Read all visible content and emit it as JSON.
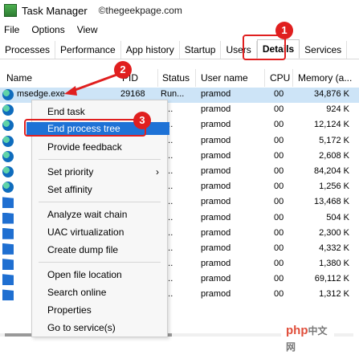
{
  "window": {
    "title": "Task Manager",
    "watermark": "©thegeekpage.com"
  },
  "menubar": [
    "File",
    "Options",
    "View"
  ],
  "tabs": [
    "Processes",
    "Performance",
    "App history",
    "Startup",
    "Users",
    "Details",
    "Services"
  ],
  "active_tab": "Details",
  "columns": {
    "name": "Name",
    "pid": "PID",
    "status": "Status",
    "user": "User name",
    "cpu": "CPU",
    "memory": "Memory (a..."
  },
  "rows": [
    {
      "name": "msedge.exe",
      "pid": "29168",
      "status": "Run...",
      "user": "pramod",
      "cpu": "00",
      "memory": "34,876 K",
      "icon": "edge"
    },
    {
      "name": "",
      "pid": "",
      "status": "n...",
      "user": "pramod",
      "cpu": "00",
      "memory": "924 K",
      "icon": "edge"
    },
    {
      "name": "",
      "pid": "",
      "status": "n...",
      "user": "pramod",
      "cpu": "00",
      "memory": "12,124 K",
      "icon": "edge"
    },
    {
      "name": "",
      "pid": "",
      "status": "n...",
      "user": "pramod",
      "cpu": "00",
      "memory": "5,172 K",
      "icon": "edge"
    },
    {
      "name": "",
      "pid": "",
      "status": "n...",
      "user": "pramod",
      "cpu": "00",
      "memory": "2,608 K",
      "icon": "edge"
    },
    {
      "name": "",
      "pid": "",
      "status": "n...",
      "user": "pramod",
      "cpu": "00",
      "memory": "84,204 K",
      "icon": "edge"
    },
    {
      "name": "",
      "pid": "",
      "status": "n...",
      "user": "pramod",
      "cpu": "00",
      "memory": "1,256 K",
      "icon": "edge"
    },
    {
      "name": "",
      "pid": "",
      "status": "n...",
      "user": "pramod",
      "cpu": "00",
      "memory": "13,468 K",
      "icon": "app"
    },
    {
      "name": "",
      "pid": "",
      "status": "n...",
      "user": "pramod",
      "cpu": "00",
      "memory": "504 K",
      "icon": "app"
    },
    {
      "name": "",
      "pid": "",
      "status": "n...",
      "user": "pramod",
      "cpu": "00",
      "memory": "2,300 K",
      "icon": "app"
    },
    {
      "name": "",
      "pid": "",
      "status": "n...",
      "user": "pramod",
      "cpu": "00",
      "memory": "4,332 K",
      "icon": "app"
    },
    {
      "name": "",
      "pid": "",
      "status": "n...",
      "user": "pramod",
      "cpu": "00",
      "memory": "1,380 K",
      "icon": "app"
    },
    {
      "name": "",
      "pid": "",
      "status": "n...",
      "user": "pramod",
      "cpu": "00",
      "memory": "69,112 K",
      "icon": "app"
    },
    {
      "name": "",
      "pid": "",
      "status": "n...",
      "user": "pramod",
      "cpu": "00",
      "memory": "1,312 K",
      "icon": "app"
    }
  ],
  "context_menu": {
    "end_task": "End task",
    "end_process_tree": "End process tree",
    "provide_feedback": "Provide feedback",
    "set_priority": "Set priority",
    "set_affinity": "Set affinity",
    "analyze_wait_chain": "Analyze wait chain",
    "uac_virtualization": "UAC virtualization",
    "create_dump_file": "Create dump file",
    "open_file_location": "Open file location",
    "search_online": "Search online",
    "properties": "Properties",
    "go_to_services": "Go to service(s)",
    "submenu_arrow": "›"
  },
  "callouts": [
    "1",
    "2",
    "3"
  ],
  "php_logo": {
    "prefix": "php",
    "suffix": "中文网"
  },
  "colors": {
    "selection": "#cde4f7",
    "menu_highlight": "#1e72d6",
    "annotation": "#e01f1f"
  }
}
